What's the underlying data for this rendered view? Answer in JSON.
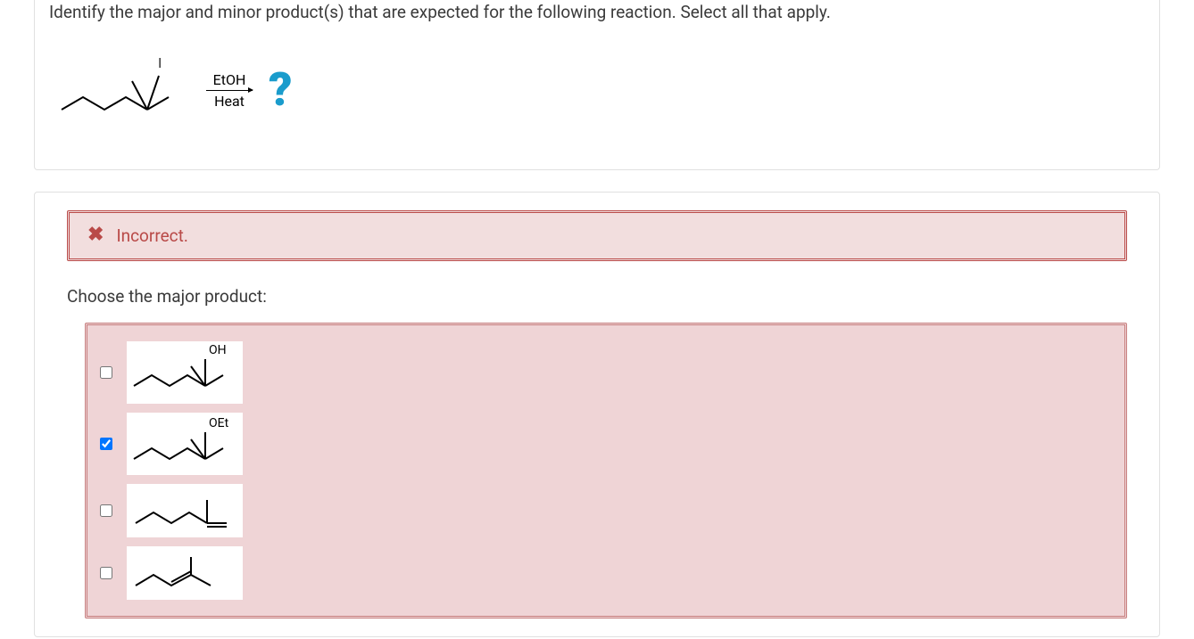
{
  "question": {
    "prompt": "Identify the major and minor product(s) that are expected for the following reaction. Select all that apply.",
    "reagent_iodine_label": "I",
    "cond_top": "EtOH",
    "cond_bottom": "Heat",
    "qmark": "?"
  },
  "feedback": {
    "status": "Incorrect."
  },
  "choose_label": "Choose the major product:",
  "options": [
    {
      "id": "opt-oh",
      "label": "OH",
      "checked": false
    },
    {
      "id": "opt-oet",
      "label": "OEt",
      "checked": true
    },
    {
      "id": "opt-alk1",
      "label": "",
      "checked": false
    },
    {
      "id": "opt-alk2",
      "label": "",
      "checked": false
    }
  ],
  "colors": {
    "error_border": "#b94a48",
    "error_bg": "#f2dede",
    "options_bg": "#efd4d6",
    "accent": "#1a9ccc"
  }
}
